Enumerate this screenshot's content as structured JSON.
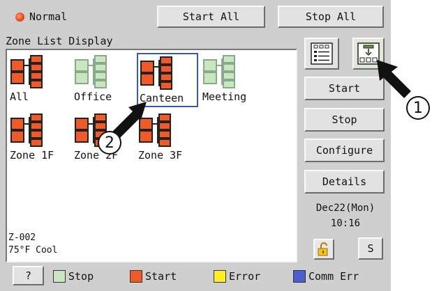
{
  "header": {
    "status_label": "Normal",
    "start_all_label": "Start All",
    "stop_all_label": "Stop All"
  },
  "zone_list": {
    "title": "Zone List Display",
    "zones": [
      {
        "label": "All",
        "state": "start"
      },
      {
        "label": "Office",
        "state": "stop"
      },
      {
        "label": "Canteen",
        "state": "start",
        "selected": true
      },
      {
        "label": "Meeting",
        "state": "stop"
      },
      {
        "label": "Zone 1F",
        "state": "start"
      },
      {
        "label": "Zone 2F",
        "state": "start"
      },
      {
        "label": "Zone 3F",
        "state": "start"
      }
    ],
    "info_line1": "Z-002",
    "info_line2": "75°F  Cool"
  },
  "side": {
    "list_view_icon": "list-view-icon",
    "icon_view_icon": "icon-view-icon",
    "start_label": "Start",
    "stop_label": "Stop",
    "configure_label": "Configure",
    "details_label": "Details",
    "date": "Dec22(Mon)",
    "time": "10:16",
    "lock_icon": "lock-icon",
    "s_label": "S"
  },
  "legend": {
    "help_label": "?",
    "items": [
      {
        "label": "Stop",
        "color": "#c8e6c0"
      },
      {
        "label": "Start",
        "color": "#f05a28"
      },
      {
        "label": "Error",
        "color": "#ffee22"
      },
      {
        "label": "Comm Err",
        "color": "#4a5fd0"
      }
    ]
  },
  "colors": {
    "start": "#f05a28",
    "stop": "#c8e6c0",
    "selection": "#3a5ab0"
  },
  "annotations": {
    "callout_1": "1",
    "callout_2": "2"
  }
}
